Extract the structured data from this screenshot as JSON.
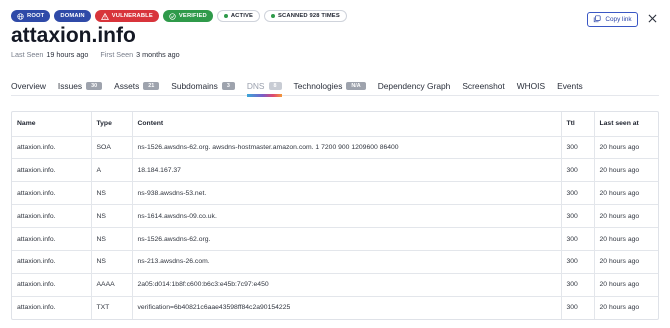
{
  "badges": {
    "root": "ROOT",
    "domain": "DOMAIN",
    "vulnerable": "VULNERABLE",
    "verified": "VERIFIED",
    "active": "ACTIVE",
    "scanned": "SCANNED 928 TIMES"
  },
  "header": {
    "title": "attaxion.info",
    "last_seen_label": "Last Seen",
    "last_seen_value": "19 hours ago",
    "first_seen_label": "First Seen",
    "first_seen_value": "3 months ago",
    "copy_link_label": "Copy link"
  },
  "tabs": [
    {
      "label": "Overview",
      "count": ""
    },
    {
      "label": "Issues",
      "count": "30"
    },
    {
      "label": "Assets",
      "count": "21"
    },
    {
      "label": "Subdomains",
      "count": "3"
    },
    {
      "label": "DNS",
      "count": "8",
      "active": true
    },
    {
      "label": "Technologies",
      "count": "N/A"
    },
    {
      "label": "Dependency Graph",
      "count": ""
    },
    {
      "label": "Screenshot",
      "count": ""
    },
    {
      "label": "WHOIS",
      "count": ""
    },
    {
      "label": "Events",
      "count": ""
    }
  ],
  "table": {
    "headers": {
      "name": "Name",
      "type": "Type",
      "content": "Content",
      "ttl": "Ttl",
      "last_seen": "Last seen at"
    },
    "rows": [
      {
        "name": "attaxion.info.",
        "type": "SOA",
        "content": "ns-1526.awsdns-62.org. awsdns-hostmaster.amazon.com. 1 7200 900 1209600 86400",
        "ttl": "300",
        "last_seen": "20 hours ago"
      },
      {
        "name": "attaxion.info.",
        "type": "A",
        "content": "18.184.167.37",
        "ttl": "300",
        "last_seen": "20 hours ago"
      },
      {
        "name": "attaxion.info.",
        "type": "NS",
        "content": "ns-938.awsdns-53.net.",
        "ttl": "300",
        "last_seen": "20 hours ago"
      },
      {
        "name": "attaxion.info.",
        "type": "NS",
        "content": "ns-1614.awsdns-09.co.uk.",
        "ttl": "300",
        "last_seen": "20 hours ago"
      },
      {
        "name": "attaxion.info.",
        "type": "NS",
        "content": "ns-1526.awsdns-62.org.",
        "ttl": "300",
        "last_seen": "20 hours ago"
      },
      {
        "name": "attaxion.info.",
        "type": "NS",
        "content": "ns-213.awsdns-26.com.",
        "ttl": "300",
        "last_seen": "20 hours ago"
      },
      {
        "name": "attaxion.info.",
        "type": "AAAA",
        "content": "2a05:d014:1b8f:c600:b6c3:e45b:7c97:e450",
        "ttl": "300",
        "last_seen": "20 hours ago"
      },
      {
        "name": "attaxion.info.",
        "type": "TXT",
        "content": "verification=6b40821c6aae43598ff84c2a90154225",
        "ttl": "300",
        "last_seen": "20 hours ago"
      }
    ]
  },
  "colors": {
    "brand": "#2f4aa8",
    "danger": "#d8343b",
    "success": "#2f9a4a"
  },
  "icons": [
    "globe-icon",
    "warning-icon",
    "check-circle-icon",
    "copy-icon",
    "close-icon"
  ]
}
